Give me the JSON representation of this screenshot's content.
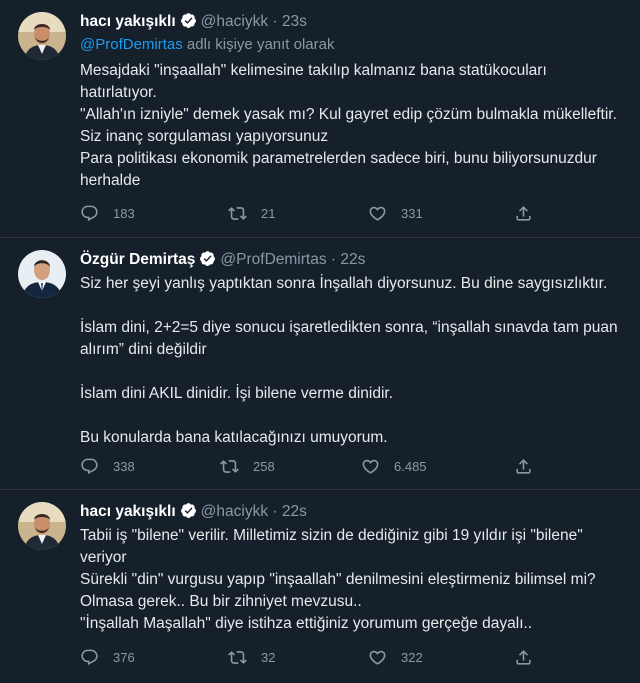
{
  "tweets": [
    {
      "name": "hacı yakışıklı",
      "handle": "@haciykk",
      "dot": "·",
      "time": "23s",
      "reply_to_mention": "@ProfDemirtas",
      "reply_to_text": " adlı kişiye yanıt olarak",
      "lines": [
        "Mesajdaki \"inşaallah\" kelimesine takılıp kalmanız bana statükocuları hatırlatıyor.",
        "\"Allah'ın izniyle\" demek yasak mı? Kul gayret edip çözüm bulmakla mükelleftir. Siz inanç sorgulaması yapıyorsunuz",
        "Para politikası ekonomik parametrelerden sadece biri, bunu biliyorsunuzdur herhalde"
      ],
      "replies": "183",
      "retweets": "21",
      "likes": "331",
      "icons": [
        "reply-icon",
        "retweet-icon",
        "like-icon",
        "share-icon"
      ]
    },
    {
      "name": "Özgür Demirtaş",
      "handle": "@ProfDemirtas",
      "dot": "·",
      "time": "22s",
      "lines": [
        "Siz her şeyi yanlış yaptıktan sonra İnşallah diyorsunuz. Bu dine saygısızlıktır.",
        "İslam dini,  2+2=5 diye sonucu işaretledikten sonra, “inşallah sınavda tam puan alırım” dini değildir",
        "İslam dini AKIL dinidir. İşi bilene verme dinidir.",
        "Bu konularda bana katılacağınızı umuyorum."
      ],
      "replies": "338",
      "retweets": "258",
      "likes": "6.485",
      "icons": [
        "reply-icon",
        "retweet-icon",
        "like-icon",
        "share-icon"
      ]
    },
    {
      "name": "hacı yakışıklı",
      "handle": "@haciykk",
      "dot": "·",
      "time": "22s",
      "lines": [
        "Tabii iş \"bilene\" verilir. Milletimiz sizin de dediğiniz gibi 19 yıldır işi \"bilene\" veriyor",
        "Sürekli \"din\" vurgusu yapıp \"inşaallah\" denilmesini eleştirmeniz bilimsel mi? Olmasa gerek.. Bu bir zihniyet mevzusu..",
        "\"İnşallah Maşallah\" diye istihza ettiğiniz yorumum gerçeğe dayalı.."
      ],
      "replies": "376",
      "retweets": "32",
      "likes": "322",
      "icons": [
        "reply-icon",
        "retweet-icon",
        "like-icon",
        "share-icon"
      ]
    }
  ],
  "colors": {
    "background": "#15202b",
    "text": "#e7e9ea",
    "muted": "#8b98a5",
    "link": "#1d9bf0"
  }
}
